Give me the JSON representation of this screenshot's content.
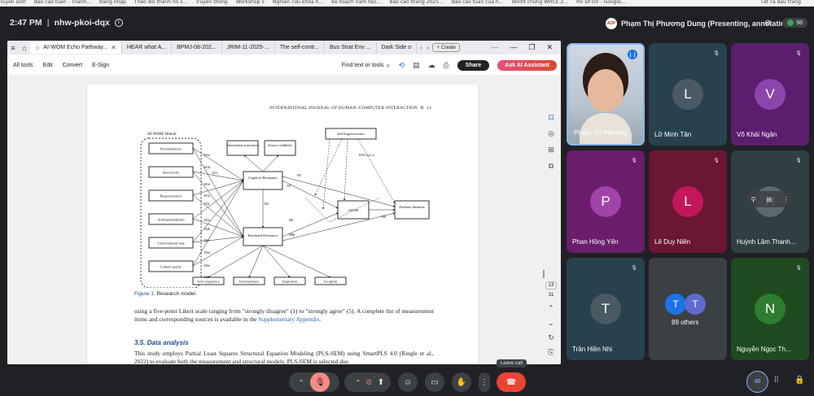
{
  "bookmarks": [
    "Tuyển sinh",
    "Báo cáo tuần - Thanh...",
    "Đăng nhập",
    "Theo dõi thành hồ s...",
    "Truyền thông",
    "Workshop 5",
    "Nghiên cứu khoa h...",
    "Kế hoạch năm học...",
    "Báo cáo tháng 2025...",
    "Báo cáo tuần của h...",
    "Winht chứng WHCE 2...",
    "Hồ sơ GV - Google..."
  ],
  "bookmark_right": "Tất cả dấu trang",
  "meet": {
    "time": "2:47 PM",
    "separator": "|",
    "code": "nhw-pkoi-dqx",
    "info_icon": "info-icon",
    "presenting": "Phạm Thị Phương Dung (Presenting, annotating)",
    "presenter_badge": "ADP",
    "participant_count": "98"
  },
  "browser": {
    "tabs": [
      {
        "label": "AI-WOM Echo Pathway...",
        "active": true
      },
      {
        "label": "HEAR what A...",
        "active": false
      },
      {
        "label": "BPMJ-08-202...",
        "active": false
      },
      {
        "label": "JRIM-11-2025-...",
        "active": false
      },
      {
        "label": "The self-contr...",
        "active": false
      },
      {
        "label": "Bus Strat Env ...",
        "active": false
      },
      {
        "label": "Dark Side o",
        "active": false
      }
    ],
    "new_tab": "Create"
  },
  "pdf_toolbar": {
    "menus": [
      "All tools",
      "Edit",
      "Convert",
      "E-Sign"
    ],
    "find": "Find text or tools",
    "share": "Share",
    "ai": "Ask AI Assistant"
  },
  "pdf_page": {
    "running_head": "INTERNATIONAL JOURNAL OF HUMAN–COMPUTER INTERACTION",
    "page_no": "13",
    "figure": {
      "group_label": "AI-WOM Stimuli",
      "stimuli": [
        "Personalization",
        "Interactivity",
        "Responsiveness",
        "Anthropomorphism",
        "Conversational tone",
        "Content quality"
      ],
      "top_boxes": [
        "Information acquisition",
        "Source credibility"
      ],
      "self_expr": "Self-Expressiveness",
      "cognitive": "Cognitive Resonance",
      "emotional": "Emotional Resonance",
      "ewom": "eWOM",
      "purchase": "Purchase Intention",
      "bottom_boxes": [
        "Self-congruence",
        "Entertainment",
        "Inspiration",
        "Escapism"
      ],
      "path_labels": {
        "h1a": "H1a",
        "h1b": "H1b",
        "h1c": "H1c",
        "h1d": "H1d",
        "h1e": "H1e",
        "h1f": "H1f",
        "h2a": "H2a",
        "h2b": "H2b",
        "h2c": "H2c",
        "h2d": "H2d",
        "h2e": "H2e",
        "h2f": "H2f",
        "h3": "H3",
        "h4": "H4",
        "h5": "H5",
        "h6": "H6",
        "h7": "H7",
        "h8a": "H8a",
        "h8b": "H8b",
        "h9": "H9",
        "h10": "H10 (a,b,c)"
      }
    },
    "caption_label": "Figure 1.",
    "caption_text": "Research model.",
    "para1": "using a five-point Likert scale ranging from \"strongly disagree\" (1) to \"strongly agree\" (5). A complete list of measurement items and corresponding sources is available in the",
    "para1_link": "Supplementary Appendix.",
    "section": "3.5. Data analysis",
    "para2": "This study employs Partial Least Squares Structural Equation Modeling (PLS-SEM) using SmartPLS 4.0 (Ringle et al., 2022) to evaluate both the measurement and structural models. PLS-SEM is selected due",
    "page_box": "13",
    "page_total": "31"
  },
  "participants": [
    {
      "name": "Phạm Thị Phương...",
      "initial": "",
      "color": "#b9c6d3",
      "video": true
    },
    {
      "name": "Lữ Minh Tân",
      "initial": "L",
      "color": "#28414f",
      "avatar": "#4a5a62"
    },
    {
      "name": "Võ Khải Ngân",
      "initial": "V",
      "color": "#5b1e6e",
      "avatar": "#8e44ad"
    },
    {
      "name": "Phan Hồng Yến",
      "initial": "P",
      "color": "#6a1d6d",
      "avatar": "#a142a8"
    },
    {
      "name": "Lê Duy Niên",
      "initial": "L",
      "color": "#6b1632",
      "avatar": "#c2185b"
    },
    {
      "name": "Huỳnh Lâm Thanh...",
      "initial": "H",
      "color": "#2f3f42",
      "avatar": "#5a6b6e"
    },
    {
      "name": "Trần Hiền Nhi",
      "initial": "T",
      "color": "#28414f",
      "avatar": "#4a5a62"
    },
    {
      "name": "89 others",
      "initial": "T",
      "color": "#3c4043",
      "avatar": "#1a73e8"
    },
    {
      "name": "Nguyễn Ngọc Th...",
      "initial": "N",
      "color": "#1f4a1f",
      "avatar": "#2e7d32"
    }
  ],
  "tooltip": "Leave call"
}
